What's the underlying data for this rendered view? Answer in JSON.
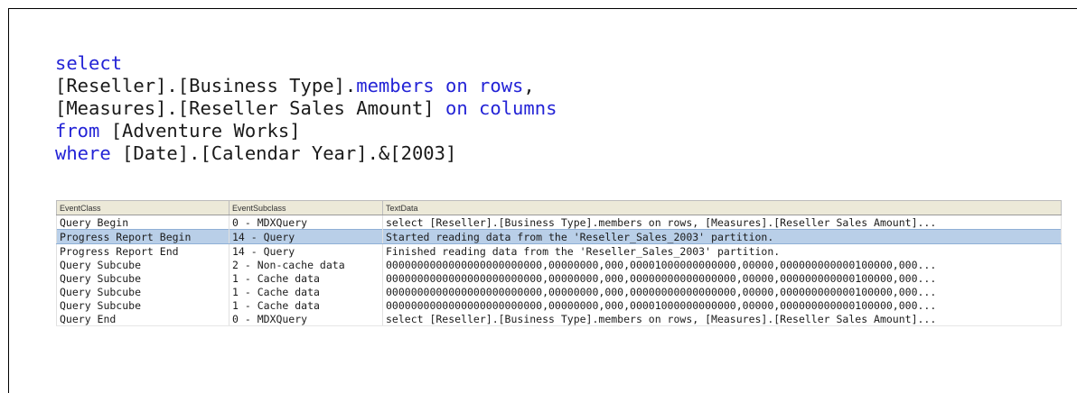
{
  "query": {
    "lines": [
      [
        {
          "t": "select",
          "kw": true
        }
      ],
      [
        {
          "t": "[Reseller].[Business Type].",
          "kw": false
        },
        {
          "t": "members on rows",
          "kw": true
        },
        {
          "t": ",",
          "kw": false
        }
      ],
      [
        {
          "t": "[Measures].[Reseller Sales Amount] ",
          "kw": false
        },
        {
          "t": "on columns",
          "kw": true
        }
      ],
      [
        {
          "t": "from",
          "kw": true
        },
        {
          "t": " [Adventure Works]",
          "kw": false
        }
      ],
      [
        {
          "t": "where",
          "kw": true
        },
        {
          "t": " [Date].[Calendar Year].&[2003]",
          "kw": false
        }
      ]
    ]
  },
  "trace": {
    "columns": [
      "EventClass",
      "EventSubclass",
      "TextData"
    ],
    "selected_row": 1,
    "rows": [
      [
        "Query Begin",
        "0 - MDXQuery",
        "select  [Reseller].[Business Type].members on rows, [Measures].[Reseller Sales Amount]..."
      ],
      [
        "Progress Report Begin",
        "14 - Query",
        "Started reading data from the 'Reseller_Sales_2003' partition."
      ],
      [
        "Progress Report End",
        "14 - Query",
        "Finished reading data from the 'Reseller_Sales_2003' partition."
      ],
      [
        "Query Subcube",
        "2 - Non-cache data",
        "0000000000000000000000000,00000000,000,00001000000000000,00000,000000000000100000,000..."
      ],
      [
        "Query Subcube",
        "1 - Cache data",
        "0000000000000000000000000,00000000,000,00000000000000000,00000,000000000000100000,000..."
      ],
      [
        "Query Subcube",
        "1 - Cache data",
        "0000000000000000000000000,00000000,000,00000000000000000,00000,000000000000100000,000..."
      ],
      [
        "Query Subcube",
        "1 - Cache data",
        "0000000000000000000000000,00000000,000,00001000000000000,00000,000000000000100000,000..."
      ],
      [
        "Query End",
        "0 - MDXQuery",
        "select  [Reseller].[Business Type].members on rows, [Measures].[Reseller Sales Amount]..."
      ]
    ]
  },
  "colors": {
    "keyword": "#2323d6",
    "text": "#1a1a1a",
    "header_bg": "#ece9d8",
    "selected_bg": "#b9cfe8"
  }
}
